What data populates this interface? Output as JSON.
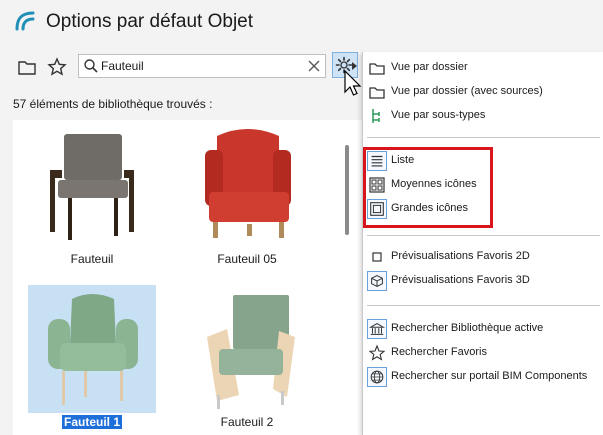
{
  "window": {
    "title": "Options par défaut Objet"
  },
  "search": {
    "value": "Fauteuil"
  },
  "results": {
    "count_label": "57 éléments de bibliothèque trouvés :"
  },
  "items": [
    {
      "label": "Fauteuil"
    },
    {
      "label": "Fauteuil 05"
    },
    {
      "label": "Fauteuil 1"
    },
    {
      "label": "Fauteuil 2"
    }
  ],
  "menu": {
    "items": [
      {
        "label": "Vue par dossier",
        "icon": "folder-icon"
      },
      {
        "label": "Vue par dossier (avec sources)",
        "icon": "folder-icon"
      },
      {
        "label": "Vue par sous-types",
        "icon": "subtype-tree-icon"
      },
      {
        "label": "Liste",
        "icon": "list-icon"
      },
      {
        "label": "Moyennes icônes",
        "icon": "medium-icons-icon"
      },
      {
        "label": "Grandes icônes",
        "icon": "large-icons-icon"
      },
      {
        "label": "Prévisualisations Favoris 2D",
        "icon": "square-icon"
      },
      {
        "label": "Prévisualisations Favoris 3D",
        "icon": "cube-icon"
      },
      {
        "label": "Rechercher Bibliothèque active",
        "icon": "library-icon"
      },
      {
        "label": "Rechercher Favoris",
        "icon": "star-icon"
      },
      {
        "label": "Rechercher sur portail BIM Components",
        "icon": "globe-icon"
      }
    ]
  },
  "colors": {
    "accent": "#1e6fd9",
    "highlight_border": "#d8141c",
    "selection_bg": "#c7e0f4",
    "app_logo": "#1f8fb8"
  }
}
